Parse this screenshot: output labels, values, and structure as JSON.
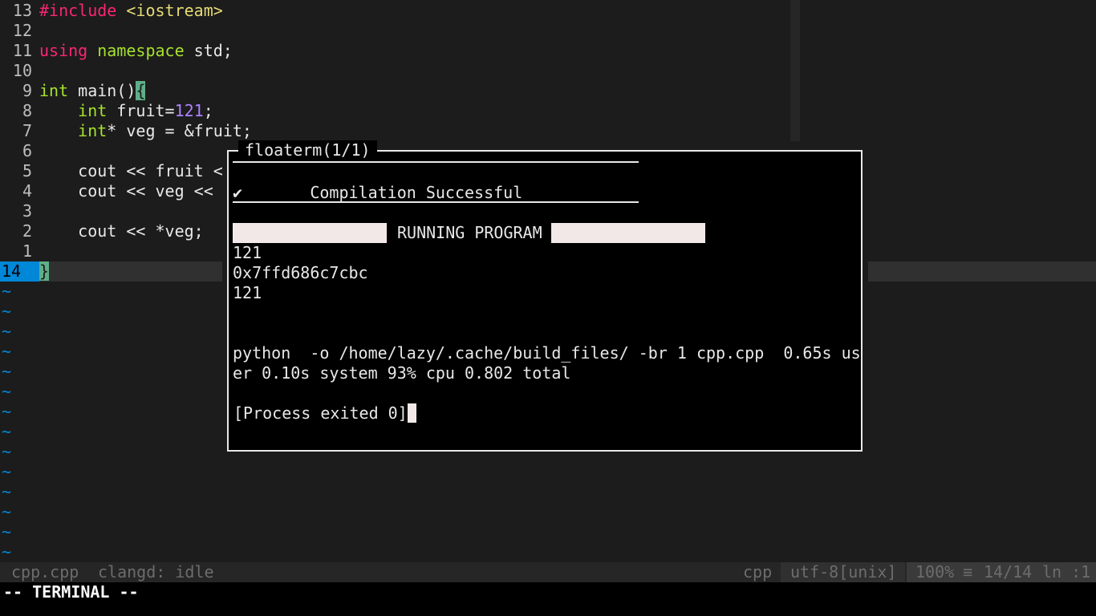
{
  "editor": {
    "lines": [
      {
        "num": "13",
        "segments": [
          {
            "cls": "pre",
            "text": "#include"
          },
          {
            "cls": "",
            "text": " "
          },
          {
            "cls": "str",
            "text": "<iostream>"
          }
        ]
      },
      {
        "num": "12",
        "segments": []
      },
      {
        "num": "11",
        "segments": [
          {
            "cls": "kw",
            "text": "using"
          },
          {
            "cls": "",
            "text": " "
          },
          {
            "cls": "ty",
            "text": "namespace"
          },
          {
            "cls": "",
            "text": " std;"
          }
        ]
      },
      {
        "num": "10",
        "segments": []
      },
      {
        "num": "9",
        "segments": [
          {
            "cls": "ty",
            "text": "int"
          },
          {
            "cls": "",
            "text": " main()"
          },
          {
            "cls": "bracket-hl",
            "text": "{"
          }
        ]
      },
      {
        "num": "8",
        "segments": [
          {
            "cls": "",
            "text": "    "
          },
          {
            "cls": "ty",
            "text": "int"
          },
          {
            "cls": "",
            "text": " fruit="
          },
          {
            "cls": "num",
            "text": "121"
          },
          {
            "cls": "",
            "text": ";"
          }
        ]
      },
      {
        "num": "7",
        "segments": [
          {
            "cls": "",
            "text": "    "
          },
          {
            "cls": "ty",
            "text": "int"
          },
          {
            "cls": "",
            "text": "* veg = &fruit;"
          }
        ]
      },
      {
        "num": "6",
        "segments": []
      },
      {
        "num": "5",
        "segments": [
          {
            "cls": "",
            "text": "    cout << fruit <"
          }
        ]
      },
      {
        "num": "4",
        "segments": [
          {
            "cls": "",
            "text": "    cout << veg << "
          }
        ]
      },
      {
        "num": "3",
        "segments": []
      },
      {
        "num": "2",
        "segments": [
          {
            "cls": "",
            "text": "    cout << *veg;"
          }
        ]
      },
      {
        "num": "1",
        "segments": []
      }
    ],
    "current_line": {
      "num": "14",
      "text": "}"
    },
    "tilde_char": "~"
  },
  "floaterm": {
    "title": "floaterm(1/1)",
    "check": "✔",
    "compile_msg": "Compilation Successful",
    "running_label": "RUNNING PROGRAM",
    "output": [
      "121",
      "0x7ffd686c7cbc",
      "121"
    ],
    "timing_line1": "python  -o /home/lazy/.cache/build_files/ -br 1 cpp.cpp  0.65s us",
    "timing_line2": "er 0.10s system 93% cpu 0.802 total",
    "exit_msg": "[Process exited 0]"
  },
  "statusline": {
    "filename": "cpp.cpp",
    "lsp": "clangd: idle",
    "filetype": "cpp",
    "encoding": "utf-8[unix]",
    "percent": "100%",
    "menu_icon": "≡",
    "position": "14/14",
    "column": "ln :1"
  },
  "cmdline": {
    "mode": "-- TERMINAL --"
  }
}
